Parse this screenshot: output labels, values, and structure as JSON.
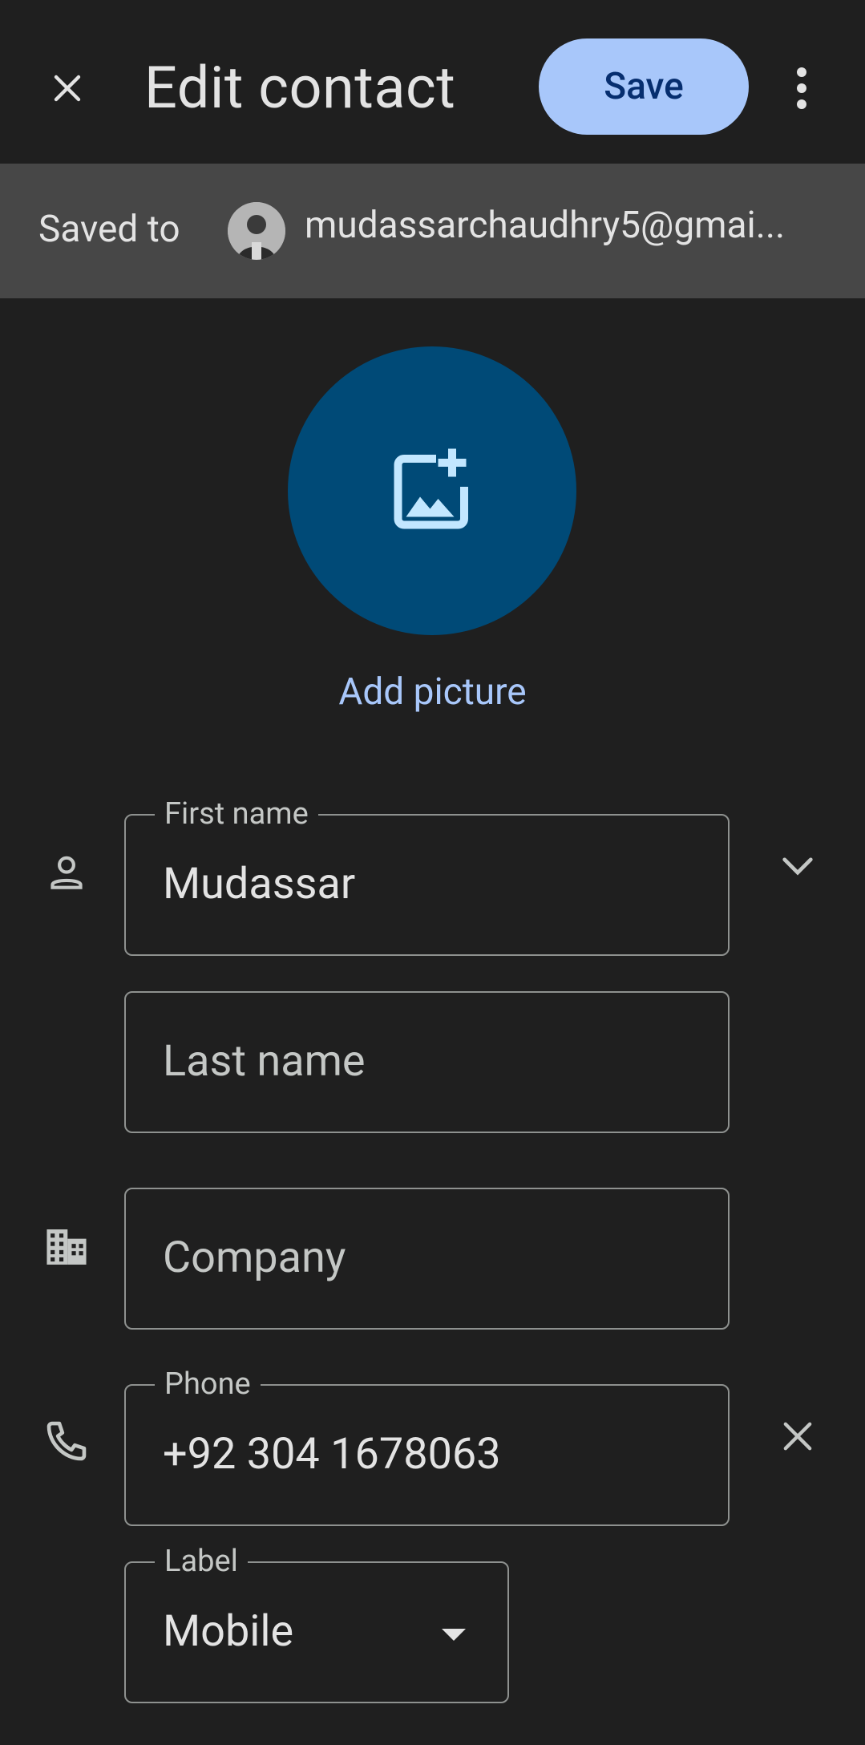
{
  "header": {
    "title": "Edit contact",
    "save_label": "Save"
  },
  "account": {
    "saved_to_label": "Saved to",
    "email": "mudassarchaudhry5@gmai..."
  },
  "photo": {
    "add_label": "Add picture"
  },
  "form": {
    "first_name": {
      "label": "First name",
      "value": "Mudassar"
    },
    "last_name": {
      "placeholder": "Last name"
    },
    "company": {
      "placeholder": "Company"
    },
    "phone": {
      "label": "Phone",
      "value": "+92 304 1678063"
    },
    "phone_type": {
      "label": "Label",
      "value": "Mobile"
    }
  },
  "colors": {
    "background": "#1f1f1f",
    "accent": "#a8c7fa",
    "photo_circle": "#004a77",
    "saved_bar": "#474747"
  },
  "icons": [
    "close-icon",
    "more-vert-icon",
    "add-photo-icon",
    "person-icon",
    "chevron-down-icon",
    "business-icon",
    "phone-icon",
    "clear-icon",
    "dropdown-arrow-icon"
  ]
}
